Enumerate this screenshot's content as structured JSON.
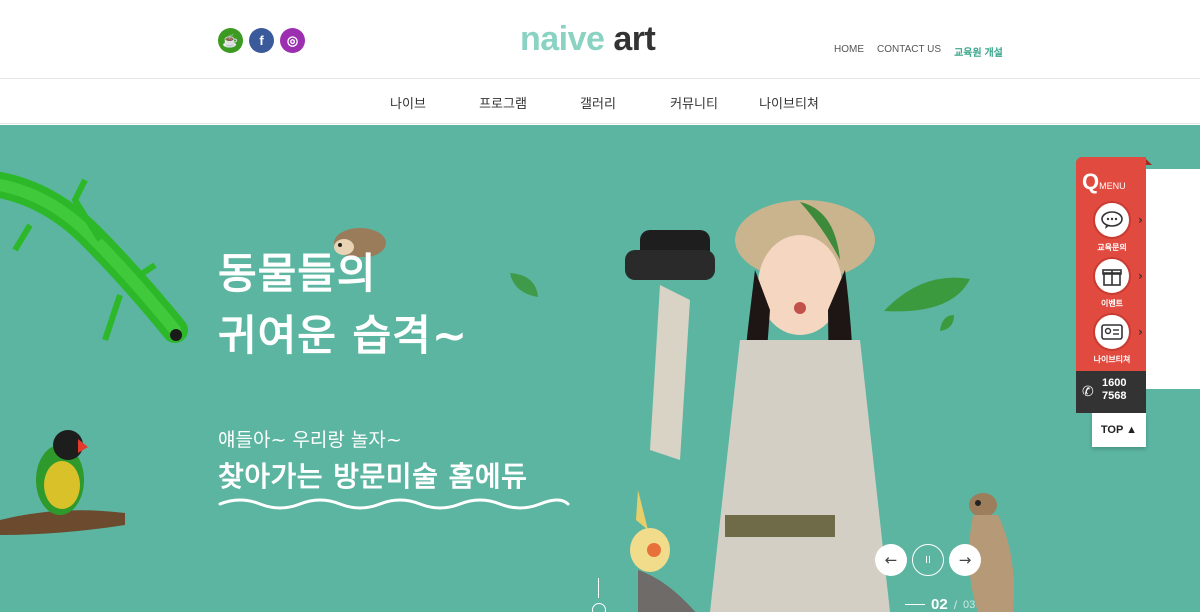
{
  "header": {
    "logo_part1": "naive",
    "logo_part2": " art",
    "sns": [
      {
        "name": "kakao-story",
        "glyph": "☕"
      },
      {
        "name": "facebook",
        "glyph": "f"
      },
      {
        "name": "instagram",
        "glyph": "◎"
      }
    ],
    "util_nav": [
      "HOME",
      "CONTACT US",
      "교육원 개설"
    ]
  },
  "gnb": {
    "items": [
      "나이브",
      "프로그램",
      "갤러리",
      "커뮤니티",
      "나이브티쳐"
    ]
  },
  "hero": {
    "headline_line1": "동물들의",
    "headline_line2": "귀여운 습격~",
    "subline": "얘들아~ 우리랑 놀자~",
    "mainline": "찾아가는 방문미술 홈에듀",
    "prev_glyph": "←",
    "pause_glyph": "II",
    "next_glyph": "→",
    "current_slide": "02",
    "pager_sep": "/",
    "total_slides": "03"
  },
  "quick_menu": {
    "title_q": "Q",
    "title_menu": "MENU",
    "items": [
      "교육문의",
      "이벤트",
      "나이브티쳐"
    ],
    "arrow": "›",
    "phone_line1": "1600",
    "phone_line2": "7568",
    "top_label": "TOP ▲"
  },
  "colors": {
    "hero_bg": "#5bb5a1",
    "brand_mint": "#8ad3c3",
    "accent_green": "#3aa68c",
    "quick_menu_red": "#e04a3f"
  }
}
